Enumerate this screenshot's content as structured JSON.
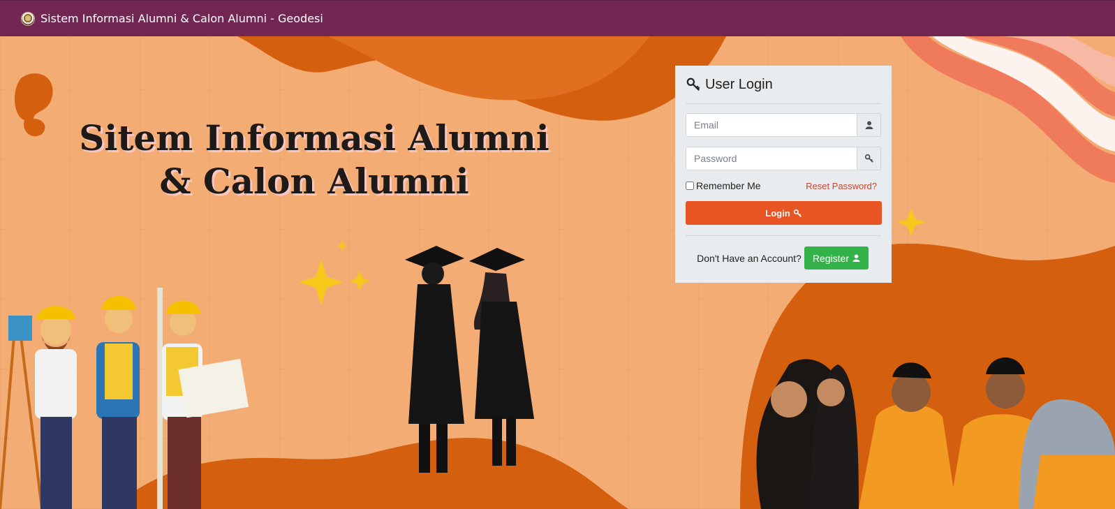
{
  "navbar": {
    "title": "Sistem Informasi Alumni & Calon Alumni - Geodesi",
    "logo_icon": "university-seal-icon"
  },
  "hero": {
    "title_line1": "Sitem Informasi Alumni",
    "title_line2": "& Calon Alumni",
    "colors": {
      "bg": "#f3ad74",
      "dark_orange": "#d45f14",
      "coral": "#f07a5c"
    }
  },
  "login": {
    "title": "User Login",
    "title_icon": "key-icon",
    "email_placeholder": "Email",
    "email_icon": "user-icon",
    "password_placeholder": "Password",
    "password_icon": "key-icon",
    "remember_label": "Remember Me",
    "reset_label": "Reset Password?",
    "login_label": "Login",
    "register_prompt": "Don't Have an Account?",
    "register_label": "Register",
    "colors": {
      "login_btn": "#e85424",
      "register_btn": "#33b249",
      "reset_link": "#c9452b"
    }
  }
}
